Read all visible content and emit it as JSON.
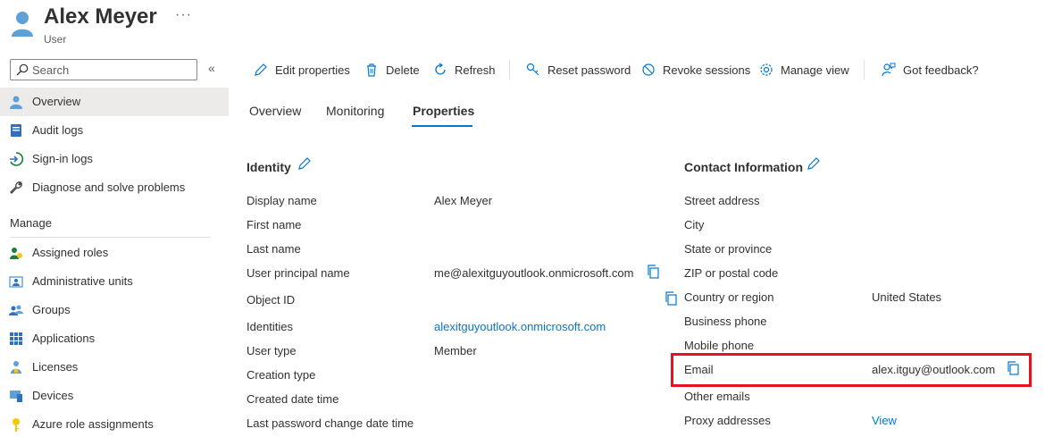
{
  "header": {
    "title": "Alex Meyer",
    "subtitle": "User",
    "more": "···"
  },
  "sidebar": {
    "search_placeholder": "Search",
    "collapse": "«",
    "items": [
      {
        "label": "Overview",
        "icon": "user-icon"
      },
      {
        "label": "Audit logs",
        "icon": "audit-log-icon"
      },
      {
        "label": "Sign-in logs",
        "icon": "sign-in-icon"
      },
      {
        "label": "Diagnose and solve problems",
        "icon": "wrench-icon"
      }
    ],
    "manage_label": "Manage",
    "manage_items": [
      {
        "label": "Assigned roles",
        "icon": "roles-icon"
      },
      {
        "label": "Administrative units",
        "icon": "admin-units-icon"
      },
      {
        "label": "Groups",
        "icon": "groups-icon"
      },
      {
        "label": "Applications",
        "icon": "applications-icon"
      },
      {
        "label": "Licenses",
        "icon": "licenses-icon"
      },
      {
        "label": "Devices",
        "icon": "devices-icon"
      },
      {
        "label": "Azure role assignments",
        "icon": "key-icon"
      }
    ]
  },
  "toolbar": {
    "edit": "Edit properties",
    "delete": "Delete",
    "refresh": "Refresh",
    "reset_password": "Reset password",
    "revoke": "Revoke sessions",
    "manage_view": "Manage view",
    "feedback": "Got feedback?"
  },
  "tabs": {
    "overview": "Overview",
    "monitoring": "Monitoring",
    "properties": "Properties"
  },
  "identity": {
    "title": "Identity",
    "rows": [
      {
        "label": "Display name",
        "value": "Alex Meyer"
      },
      {
        "label": "First name",
        "value": ""
      },
      {
        "label": "Last name",
        "value": ""
      },
      {
        "label": "User principal name",
        "value": "me@alexitguyoutlook.onmicrosoft.com"
      },
      {
        "label": "Object ID",
        "value": ""
      },
      {
        "label": "Identities",
        "value": "alexitguyoutlook.onmicrosoft.com"
      },
      {
        "label": "User type",
        "value": "Member"
      },
      {
        "label": "Creation type",
        "value": ""
      },
      {
        "label": "Created date time",
        "value": ""
      },
      {
        "label": "Last password change date time",
        "value": ""
      }
    ]
  },
  "contact": {
    "title": "Contact Information",
    "rows": [
      {
        "label": "Street address",
        "value": ""
      },
      {
        "label": "City",
        "value": ""
      },
      {
        "label": "State or province",
        "value": ""
      },
      {
        "label": "ZIP or postal code",
        "value": ""
      },
      {
        "label": "Country or region",
        "value": "United States"
      },
      {
        "label": "Business phone",
        "value": ""
      },
      {
        "label": "Mobile phone",
        "value": ""
      },
      {
        "label": "Email",
        "value": "alex.itguy@outlook.com"
      },
      {
        "label": "Other emails",
        "value": ""
      },
      {
        "label": "Proxy addresses",
        "value": "View"
      }
    ]
  },
  "colors": {
    "accent": "#0078d4",
    "highlight": "#e81123",
    "active_nav": "#edebe9"
  }
}
